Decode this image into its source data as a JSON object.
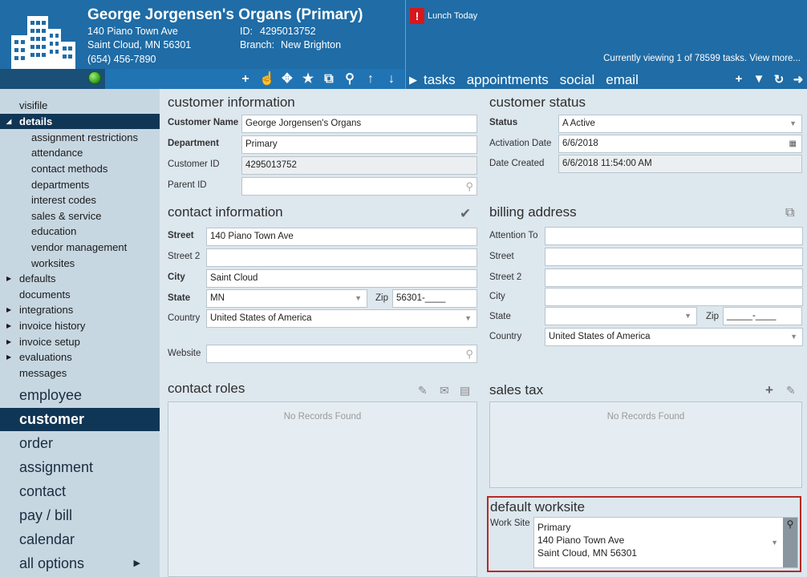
{
  "header": {
    "customer_name": "George Jorgensen's Organs (Primary)",
    "address1": "140 Piano Town Ave",
    "address2": "Saint Cloud, MN   56301",
    "phone": "(654) 456-7890",
    "id_label": "ID:",
    "id_value": "4295013752",
    "branch_label": "Branch:",
    "branch_value": "New Brighton",
    "alert_text": "Lunch Today",
    "tasks_info": "Currently viewing 1 of 78599 tasks. View more...",
    "tabs": [
      "tasks",
      "appointments",
      "social",
      "email"
    ],
    "toolbar_icons": [
      "add-icon",
      "pointer-icon",
      "puzzle-icon",
      "star-icon",
      "external-icon",
      "search-icon",
      "up-arrow-icon",
      "down-arrow-icon"
    ],
    "right_icons": [
      "add-icon",
      "filter-icon",
      "refresh-icon",
      "forward-icon"
    ]
  },
  "sidebar": {
    "items": [
      {
        "label": "visifile"
      },
      {
        "label": "details",
        "expanded": true,
        "active": true
      },
      {
        "label": "assignment restrictions"
      },
      {
        "label": "attendance"
      },
      {
        "label": "contact methods"
      },
      {
        "label": "departments"
      },
      {
        "label": "interest codes"
      },
      {
        "label": "sales & service"
      },
      {
        "label": "education"
      },
      {
        "label": "vendor management"
      },
      {
        "label": "worksites"
      },
      {
        "label": "defaults"
      },
      {
        "label": "documents"
      },
      {
        "label": "integrations"
      },
      {
        "label": "invoice history"
      },
      {
        "label": "invoice setup"
      },
      {
        "label": "evaluations"
      },
      {
        "label": "messages"
      }
    ],
    "big_items": [
      {
        "label": "employee"
      },
      {
        "label": "customer",
        "active": true
      },
      {
        "label": "order"
      },
      {
        "label": "assignment"
      },
      {
        "label": "contact"
      },
      {
        "label": "pay / bill"
      },
      {
        "label": "calendar"
      },
      {
        "label": "all options"
      }
    ]
  },
  "customer_info": {
    "title": "customer information",
    "name_label": "Customer Name",
    "name_value": "George Jorgensen's Organs",
    "dept_label": "Department",
    "dept_value": "Primary",
    "id_label": "Customer ID",
    "id_value": "4295013752",
    "parent_label": "Parent ID",
    "parent_value": ""
  },
  "customer_status": {
    "title": "customer status",
    "status_label": "Status",
    "status_value": "A  Active",
    "activation_label": "Activation Date",
    "activation_value": "6/6/2018",
    "created_label": "Date Created",
    "created_value": "6/6/2018 11:54:00 AM"
  },
  "contact_info": {
    "title": "contact information",
    "street_label": "Street",
    "street_value": "140 Piano Town Ave",
    "street2_label": "Street 2",
    "street2_value": "",
    "city_label": "City",
    "city_value": "Saint Cloud",
    "state_label": "State",
    "state_value": "MN",
    "zip_label": "Zip",
    "zip_value": "56301-____",
    "country_label": "Country",
    "country_value": "United States of America",
    "website_label": "Website",
    "website_value": ""
  },
  "billing": {
    "title": "billing address",
    "attention_label": "Attention To",
    "street_label": "Street",
    "street2_label": "Street 2",
    "city_label": "City",
    "state_label": "State",
    "zip_label": "Zip",
    "zip_value": "_____-____",
    "country_label": "Country",
    "country_value": "United States of America"
  },
  "contact_roles": {
    "title": "contact roles",
    "empty": "No Records Found"
  },
  "sales_tax": {
    "title": "sales tax",
    "empty": "No Records Found"
  },
  "worksite": {
    "title": "default worksite",
    "label": "Work Site",
    "line1": "Primary",
    "line2": "140 Piano Town Ave",
    "line3": "Saint Cloud, MN 56301"
  },
  "colors": {
    "header": "#1f6ca6",
    "sidebar_active": "#103656",
    "highlight": "#b52b25",
    "alert": "#d9161c"
  }
}
